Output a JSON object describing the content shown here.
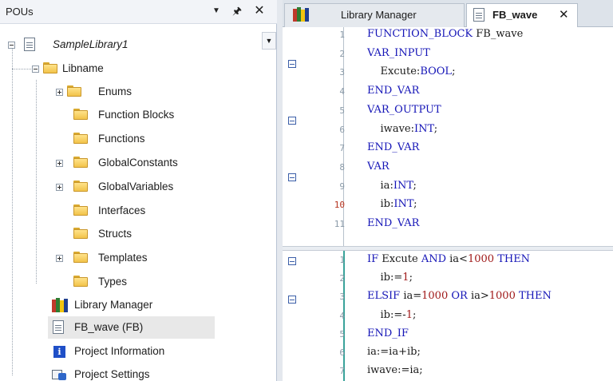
{
  "pous_panel": {
    "title": "POUs",
    "dropdown_icon": "dropdown-arrow-icon",
    "pin_icon": "pin-icon",
    "close_icon": "close-icon",
    "tree": {
      "root": "SampleLibrary1",
      "libname": "Libname",
      "folders": [
        "Enums",
        "Function Blocks",
        "Functions",
        "GlobalConstants",
        "GlobalVariables",
        "Interfaces",
        "Structs",
        "Templates",
        "Types"
      ],
      "library_manager": "Library Manager",
      "fb_wave": "FB_wave (FB)",
      "project_information": "Project Information",
      "project_settings": "Project Settings"
    }
  },
  "editor": {
    "tabs": [
      {
        "label": "Library Manager"
      },
      {
        "label": "FB_wave"
      }
    ],
    "declaration": {
      "line_numbers": [
        "1",
        "2",
        "3",
        "4",
        "5",
        "6",
        "7",
        "8",
        "9",
        "10",
        "11"
      ],
      "lines": [
        [
          "FUNCTION_BLOCK",
          " FB_wave"
        ],
        [
          "VAR_INPUT",
          ""
        ],
        [
          "    Excute:",
          "BOOL",
          ";"
        ],
        [
          "END_VAR",
          ""
        ],
        [
          "VAR_OUTPUT",
          ""
        ],
        [
          "    iwave:",
          "INT",
          ";"
        ],
        [
          "END_VAR",
          ""
        ],
        [
          "VAR",
          ""
        ],
        [
          "    ia:",
          "INT",
          ";"
        ],
        [
          "    ib:",
          "INT",
          ";"
        ],
        [
          "END_VAR",
          ""
        ]
      ]
    },
    "implementation": {
      "line_numbers": [
        "1",
        "2",
        "3",
        "4",
        "5",
        "6",
        "7"
      ],
      "lines": {
        "l1": {
          "a": "IF",
          "b": " Excute ",
          "c": "AND",
          "d": " ia<",
          "e": "1000",
          "f": " ",
          "g": "THEN"
        },
        "l2": {
          "a": "    ib:=",
          "b": "1",
          "c": ";"
        },
        "l3": {
          "a": "ELSIF",
          "b": " ia=",
          "c": "1000",
          "d": " ",
          "e": "OR",
          "f": " ia>",
          "g": "1000",
          "h": " ",
          "i": "THEN"
        },
        "l4": {
          "a": "    ib:=-",
          "b": "1",
          "c": ";"
        },
        "l5": {
          "a": "END_IF"
        },
        "l6": {
          "a": "ia:=ia+ib;"
        },
        "l7": {
          "a": "iwave:=ia;"
        }
      }
    }
  },
  "colors": {
    "keyword": "#1515b7",
    "number": "#a01a1a",
    "line_number_highlight": "#b5331f"
  }
}
